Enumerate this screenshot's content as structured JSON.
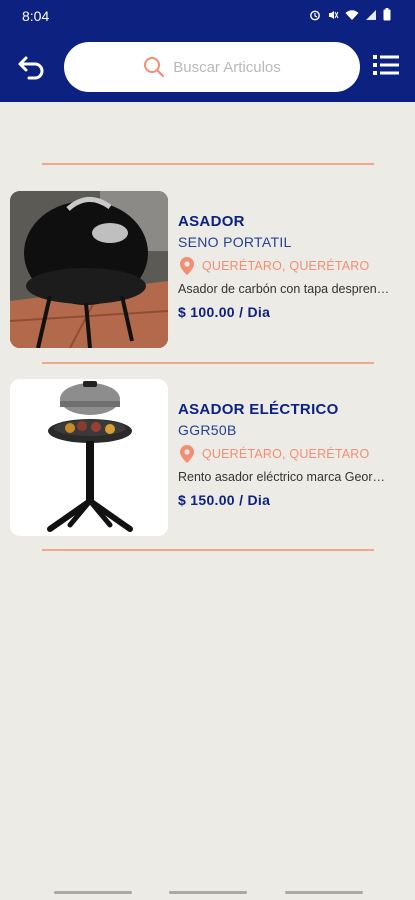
{
  "status": {
    "time": "8:04"
  },
  "search": {
    "placeholder": "Buscar Articulos"
  },
  "items": [
    {
      "title": "ASADOR",
      "subtitle": "SENO PORTATIL",
      "location": "QUERÉTARO, QUERÉTARO",
      "description": "Asador de carbón con tapa desprend ...",
      "price": "$ 100.00 / Dia"
    },
    {
      "title": "ASADOR ELÉCTRICO",
      "subtitle": "GGR50B",
      "location": "QUERÉTARO, QUERÉTARO",
      "description": "Rento asador eléctrico marca Georg ...",
      "price": "$ 150.00 / Dia"
    }
  ],
  "colors": {
    "header": "#0d2280",
    "accent": "#f28e73",
    "divider": "#f0a88d",
    "background": "#ecebe6"
  },
  "icons": [
    "back-arrow-icon",
    "search-icon",
    "list-icon",
    "location-pin-icon",
    "wifi-icon",
    "signal-icon",
    "battery-icon"
  ]
}
